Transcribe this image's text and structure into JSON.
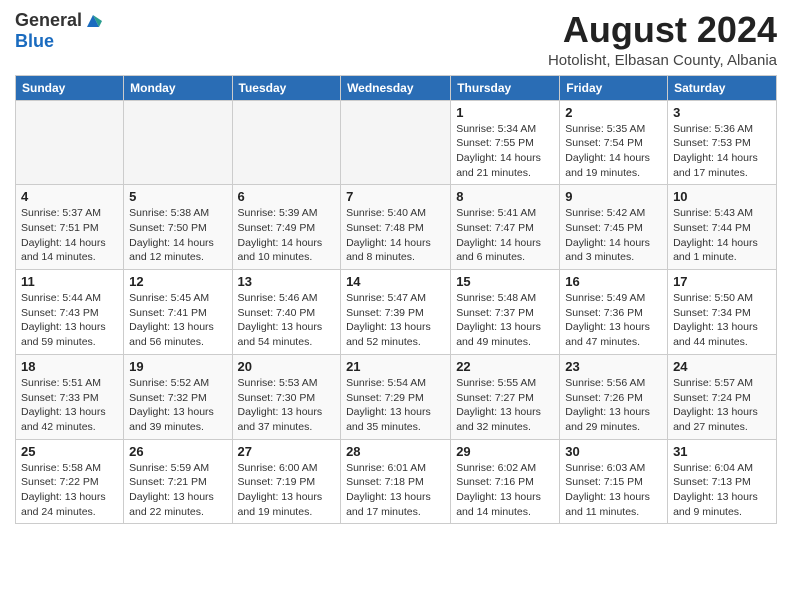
{
  "header": {
    "logo_general": "General",
    "logo_blue": "Blue",
    "month_year": "August 2024",
    "location": "Hotolisht, Elbasan County, Albania"
  },
  "days_of_week": [
    "Sunday",
    "Monday",
    "Tuesday",
    "Wednesday",
    "Thursday",
    "Friday",
    "Saturday"
  ],
  "weeks": [
    [
      {
        "day": "",
        "info": ""
      },
      {
        "day": "",
        "info": ""
      },
      {
        "day": "",
        "info": ""
      },
      {
        "day": "",
        "info": ""
      },
      {
        "day": "1",
        "info": "Sunrise: 5:34 AM\nSunset: 7:55 PM\nDaylight: 14 hours\nand 21 minutes."
      },
      {
        "day": "2",
        "info": "Sunrise: 5:35 AM\nSunset: 7:54 PM\nDaylight: 14 hours\nand 19 minutes."
      },
      {
        "day": "3",
        "info": "Sunrise: 5:36 AM\nSunset: 7:53 PM\nDaylight: 14 hours\nand 17 minutes."
      }
    ],
    [
      {
        "day": "4",
        "info": "Sunrise: 5:37 AM\nSunset: 7:51 PM\nDaylight: 14 hours\nand 14 minutes."
      },
      {
        "day": "5",
        "info": "Sunrise: 5:38 AM\nSunset: 7:50 PM\nDaylight: 14 hours\nand 12 minutes."
      },
      {
        "day": "6",
        "info": "Sunrise: 5:39 AM\nSunset: 7:49 PM\nDaylight: 14 hours\nand 10 minutes."
      },
      {
        "day": "7",
        "info": "Sunrise: 5:40 AM\nSunset: 7:48 PM\nDaylight: 14 hours\nand 8 minutes."
      },
      {
        "day": "8",
        "info": "Sunrise: 5:41 AM\nSunset: 7:47 PM\nDaylight: 14 hours\nand 6 minutes."
      },
      {
        "day": "9",
        "info": "Sunrise: 5:42 AM\nSunset: 7:45 PM\nDaylight: 14 hours\nand 3 minutes."
      },
      {
        "day": "10",
        "info": "Sunrise: 5:43 AM\nSunset: 7:44 PM\nDaylight: 14 hours\nand 1 minute."
      }
    ],
    [
      {
        "day": "11",
        "info": "Sunrise: 5:44 AM\nSunset: 7:43 PM\nDaylight: 13 hours\nand 59 minutes."
      },
      {
        "day": "12",
        "info": "Sunrise: 5:45 AM\nSunset: 7:41 PM\nDaylight: 13 hours\nand 56 minutes."
      },
      {
        "day": "13",
        "info": "Sunrise: 5:46 AM\nSunset: 7:40 PM\nDaylight: 13 hours\nand 54 minutes."
      },
      {
        "day": "14",
        "info": "Sunrise: 5:47 AM\nSunset: 7:39 PM\nDaylight: 13 hours\nand 52 minutes."
      },
      {
        "day": "15",
        "info": "Sunrise: 5:48 AM\nSunset: 7:37 PM\nDaylight: 13 hours\nand 49 minutes."
      },
      {
        "day": "16",
        "info": "Sunrise: 5:49 AM\nSunset: 7:36 PM\nDaylight: 13 hours\nand 47 minutes."
      },
      {
        "day": "17",
        "info": "Sunrise: 5:50 AM\nSunset: 7:34 PM\nDaylight: 13 hours\nand 44 minutes."
      }
    ],
    [
      {
        "day": "18",
        "info": "Sunrise: 5:51 AM\nSunset: 7:33 PM\nDaylight: 13 hours\nand 42 minutes."
      },
      {
        "day": "19",
        "info": "Sunrise: 5:52 AM\nSunset: 7:32 PM\nDaylight: 13 hours\nand 39 minutes."
      },
      {
        "day": "20",
        "info": "Sunrise: 5:53 AM\nSunset: 7:30 PM\nDaylight: 13 hours\nand 37 minutes."
      },
      {
        "day": "21",
        "info": "Sunrise: 5:54 AM\nSunset: 7:29 PM\nDaylight: 13 hours\nand 35 minutes."
      },
      {
        "day": "22",
        "info": "Sunrise: 5:55 AM\nSunset: 7:27 PM\nDaylight: 13 hours\nand 32 minutes."
      },
      {
        "day": "23",
        "info": "Sunrise: 5:56 AM\nSunset: 7:26 PM\nDaylight: 13 hours\nand 29 minutes."
      },
      {
        "day": "24",
        "info": "Sunrise: 5:57 AM\nSunset: 7:24 PM\nDaylight: 13 hours\nand 27 minutes."
      }
    ],
    [
      {
        "day": "25",
        "info": "Sunrise: 5:58 AM\nSunset: 7:22 PM\nDaylight: 13 hours\nand 24 minutes."
      },
      {
        "day": "26",
        "info": "Sunrise: 5:59 AM\nSunset: 7:21 PM\nDaylight: 13 hours\nand 22 minutes."
      },
      {
        "day": "27",
        "info": "Sunrise: 6:00 AM\nSunset: 7:19 PM\nDaylight: 13 hours\nand 19 minutes."
      },
      {
        "day": "28",
        "info": "Sunrise: 6:01 AM\nSunset: 7:18 PM\nDaylight: 13 hours\nand 17 minutes."
      },
      {
        "day": "29",
        "info": "Sunrise: 6:02 AM\nSunset: 7:16 PM\nDaylight: 13 hours\nand 14 minutes."
      },
      {
        "day": "30",
        "info": "Sunrise: 6:03 AM\nSunset: 7:15 PM\nDaylight: 13 hours\nand 11 minutes."
      },
      {
        "day": "31",
        "info": "Sunrise: 6:04 AM\nSunset: 7:13 PM\nDaylight: 13 hours\nand 9 minutes."
      }
    ]
  ]
}
